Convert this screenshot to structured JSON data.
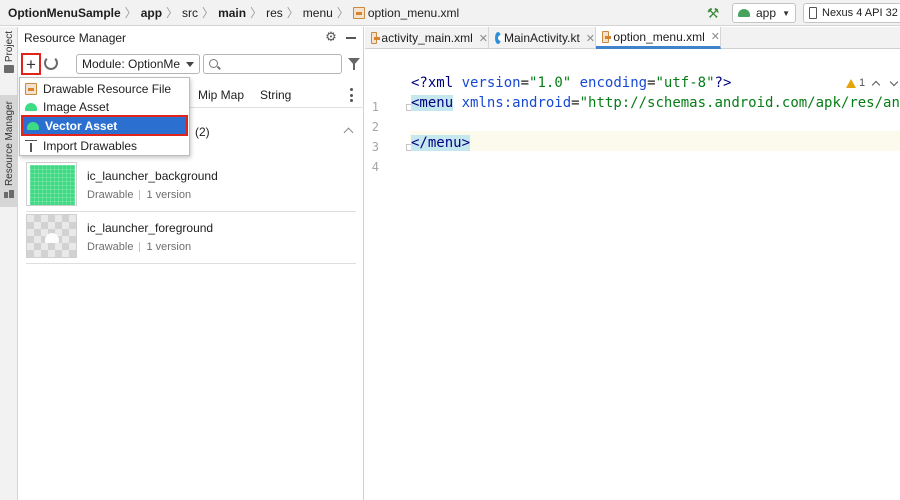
{
  "breadcrumb": {
    "project": "OptionMenuSample",
    "items": [
      "app",
      "src",
      "main",
      "res",
      "menu"
    ],
    "file": "option_menu.xml"
  },
  "toolbar": {
    "run_config": "app",
    "device": "Nexus 4 API 32"
  },
  "side_tabs": {
    "project": "Project",
    "resource_manager": "Resource Manager"
  },
  "resource_manager": {
    "title": "Resource Manager",
    "module_select": "Module: OptionMe",
    "search_placeholder": "",
    "tabs": [
      "Mip Map",
      "String"
    ],
    "group_count": "(2)",
    "items": [
      {
        "name": "ic_launcher_background",
        "type": "Drawable",
        "versions": "1 version"
      },
      {
        "name": "ic_launcher_foreground",
        "type": "Drawable",
        "versions": "1 version"
      }
    ]
  },
  "add_menu": {
    "items": [
      {
        "label": "Drawable Resource File",
        "icon": "xml-file-icon"
      },
      {
        "label": "Image Asset",
        "icon": "android-icon"
      },
      {
        "label": "Vector Asset",
        "icon": "android-icon",
        "selected": true
      },
      {
        "label": "Import Drawables",
        "icon": "import-icon"
      }
    ]
  },
  "editor": {
    "tabs": [
      {
        "label": "activity_main.xml",
        "icon": "xml-file-icon"
      },
      {
        "label": "MainActivity.kt",
        "icon": "kotlin-icon"
      },
      {
        "label": "option_menu.xml",
        "icon": "xml-file-icon",
        "active": true
      }
    ],
    "line_numbers": [
      "1",
      "2",
      "3",
      "4"
    ],
    "lines": [
      [
        {
          "t": "<?xml ",
          "c": "tag"
        },
        {
          "t": "version",
          "c": "attr"
        },
        {
          "t": "=",
          "c": "plain"
        },
        {
          "t": "\"1.0\"",
          "c": "str"
        },
        {
          "t": " ",
          "c": "plain"
        },
        {
          "t": "encoding",
          "c": "attr"
        },
        {
          "t": "=",
          "c": "plain"
        },
        {
          "t": "\"utf-8\"",
          "c": "str"
        },
        {
          "t": "?>",
          "c": "tag"
        }
      ],
      [
        {
          "t": "<menu",
          "c": "tag",
          "hl": true
        },
        {
          "t": " ",
          "c": "plain"
        },
        {
          "t": "xmlns:android",
          "c": "attr"
        },
        {
          "t": "=",
          "c": "plain"
        },
        {
          "t": "\"http://schemas.android.com/apk/res/an",
          "c": "str"
        }
      ],
      [],
      [
        {
          "t": "</menu>",
          "c": "tag",
          "hl": true
        }
      ]
    ],
    "warning_count": "1"
  },
  "colors": {
    "accent": "#2b6fd0",
    "highlight_border": "#e0241b",
    "android_green": "#3ddc84"
  }
}
